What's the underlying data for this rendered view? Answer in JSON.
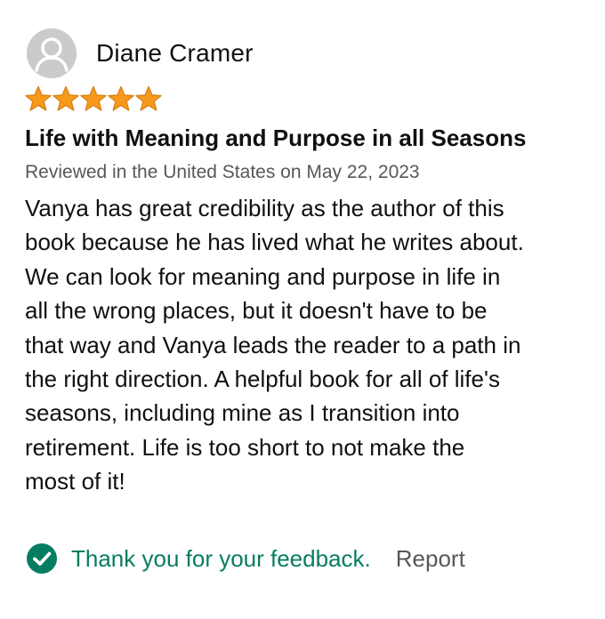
{
  "reviewer": {
    "name": "Diane Cramer",
    "avatar_icon": "default-profile-icon"
  },
  "rating": {
    "stars": 5,
    "max": 5,
    "star_color": "#f79a1c"
  },
  "review": {
    "title": "Life with Meaning and Purpose in all Seasons",
    "date": "Reviewed in the United States on May 22, 2023",
    "body_lines": [
      "Vanya has great credibility as the author of this",
      "book because he has lived what he writes about.",
      "We can look for meaning and purpose in life in",
      "all the wrong places, but it doesn't have to be",
      "that way and Vanya leads the reader to a path in",
      "the right direction. A helpful book for all of life's",
      "seasons, including mine as I transition into",
      "retirement. Life is too short to not make the",
      "most of it!"
    ]
  },
  "feedback": {
    "icon": "check-circle-icon",
    "icon_color": "#067d62",
    "thanks_text": "Thank you for your feedback.",
    "report_label": "Report"
  }
}
